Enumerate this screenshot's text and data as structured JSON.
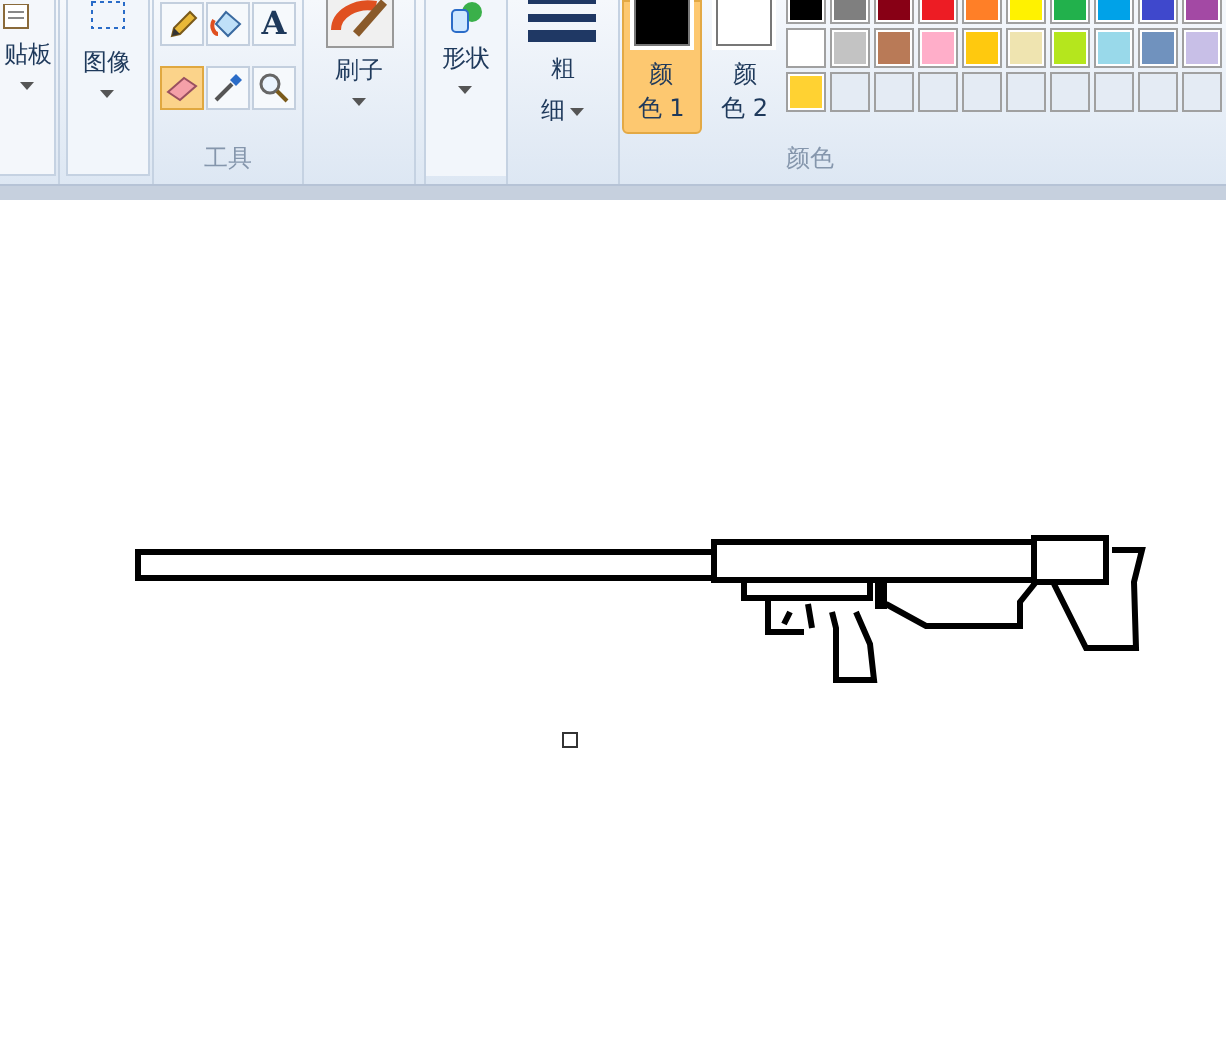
{
  "ribbon": {
    "groups": [
      {
        "kind": "clipboard",
        "label": "贴板"
      },
      {
        "kind": "image",
        "label": "图像"
      },
      {
        "kind": "tools",
        "footer": "工具",
        "tools": [
          {
            "kind": "pencil",
            "selected": false
          },
          {
            "kind": "fill",
            "selected": false
          },
          {
            "kind": "text",
            "glyph": "A",
            "selected": false
          },
          {
            "kind": "eraser",
            "selected": true
          },
          {
            "kind": "picker",
            "selected": false
          },
          {
            "kind": "magnifier",
            "selected": false
          }
        ]
      },
      {
        "kind": "brushes",
        "label": "刷子"
      },
      {
        "kind": "shapes",
        "label": "形状"
      },
      {
        "kind": "size",
        "label_top": "粗",
        "label_bottom": "细"
      },
      {
        "kind": "color1",
        "label_top": "颜",
        "label_bottom": "色 1",
        "color": "#000000",
        "selected": true
      },
      {
        "kind": "color2",
        "label_top": "颜",
        "label_bottom": "色 2",
        "color": "#ffffff",
        "selected": false
      },
      {
        "kind": "palette",
        "footer": "颜色",
        "swatches": [
          {
            "color": "#000000"
          },
          {
            "color": "#7f7f7f"
          },
          {
            "color": "#880015"
          },
          {
            "color": "#ed1c24"
          },
          {
            "color": "#ff7f27"
          },
          {
            "color": "#fff200"
          },
          {
            "color": "#22b14c"
          },
          {
            "color": "#00a2e8"
          },
          {
            "color": "#3f48cc"
          },
          {
            "color": "#a349a4"
          },
          {
            "color": "#ffffff"
          },
          {
            "color": "#c3c3c3"
          },
          {
            "color": "#b97a57"
          },
          {
            "color": "#ffaec9"
          },
          {
            "color": "#ffc90e"
          },
          {
            "color": "#efe4b0"
          },
          {
            "color": "#b5e61d"
          },
          {
            "color": "#99d9ea"
          },
          {
            "color": "#7092be"
          },
          {
            "color": "#c8bfe7"
          },
          {
            "color": "#ffd232"
          },
          {
            "kind": "empty"
          },
          {
            "kind": "empty"
          },
          {
            "kind": "empty"
          },
          {
            "kind": "empty"
          },
          {
            "kind": "empty"
          },
          {
            "kind": "empty"
          },
          {
            "kind": "empty"
          },
          {
            "kind": "empty"
          },
          {
            "kind": "empty"
          }
        ]
      }
    ]
  }
}
